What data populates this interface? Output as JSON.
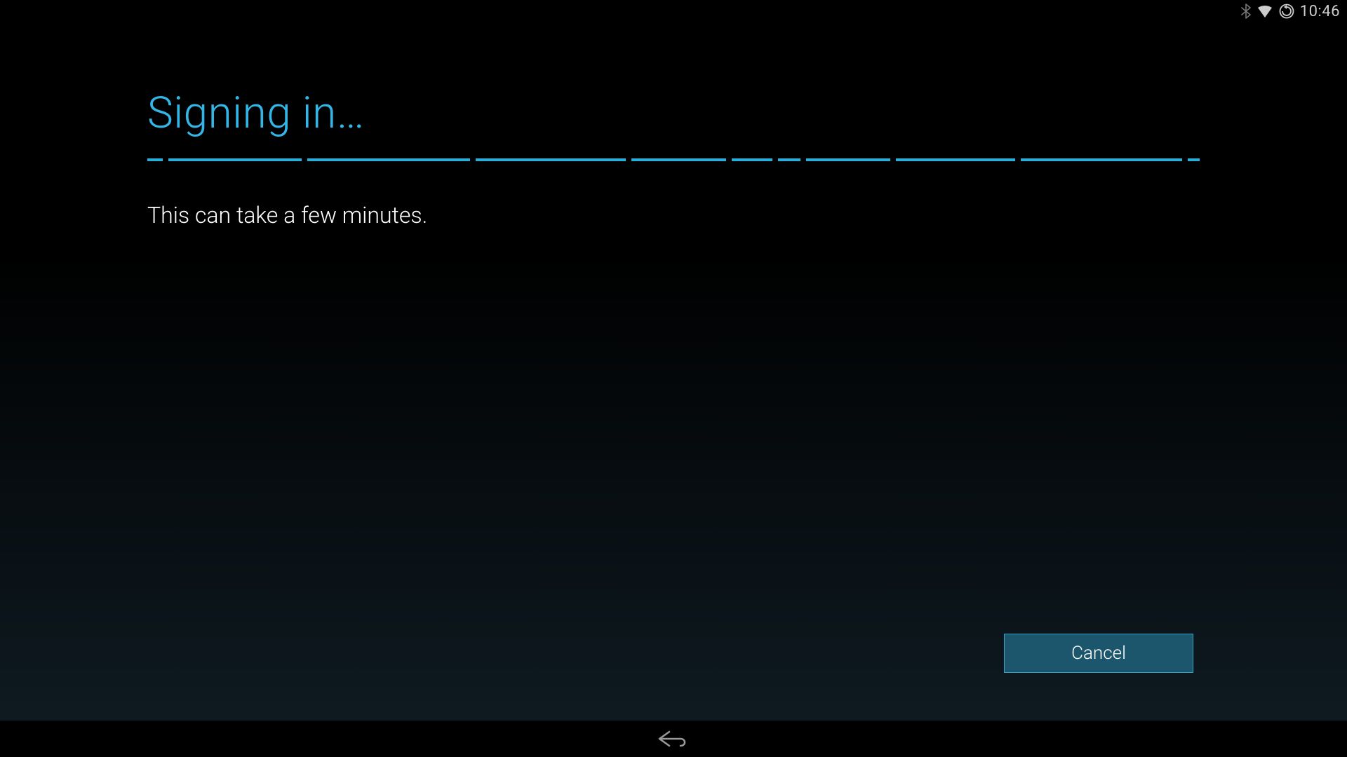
{
  "statusbar": {
    "time": "10:46"
  },
  "page": {
    "title": "Signing in…",
    "subtitle": "This can take a few minutes."
  },
  "actions": {
    "cancel_label": "Cancel"
  },
  "colors": {
    "accent": "#33b5e5",
    "button_bg": "#1b566c",
    "button_border": "#3aa1c6"
  }
}
